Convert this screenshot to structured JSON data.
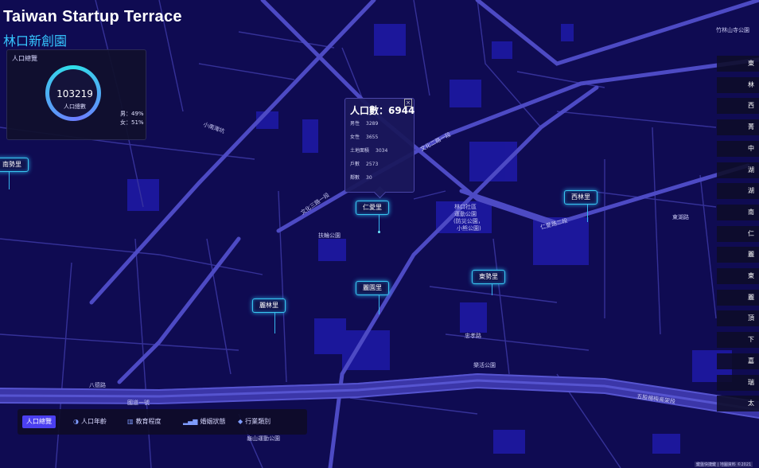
{
  "app": {
    "title": "Taiwan Startup Terrace",
    "subtitle": "林口新創園"
  },
  "population_panel": {
    "title": "人口總覽",
    "total": "103219",
    "total_label": "人口總數",
    "male": "男：49%",
    "female": "女：51%",
    "male_fraction": 0.49
  },
  "tooltip": {
    "heading": "人口數：6944",
    "close": "×",
    "rows": [
      {
        "label": "男性",
        "value": "3289"
      },
      {
        "label": "女性",
        "value": "3655"
      },
      {
        "label": "土地面積",
        "value": "3034"
      },
      {
        "label": "戶數",
        "value": "2573"
      },
      {
        "label": "鄰數",
        "value": "30"
      }
    ]
  },
  "village_labels": [
    "南勢里",
    "仁愛里",
    "西林里",
    "東勢里",
    "麗園里",
    "麗林里"
  ],
  "right_tabs": [
    "東",
    "林",
    "西",
    "菁",
    "中",
    "湖",
    "湖",
    "南",
    "仁",
    "麗",
    "東",
    "麗",
    "頂",
    "下",
    "嘉",
    "瑞",
    "太"
  ],
  "bottom_tabs": [
    {
      "label": "人口總覽",
      "icon": "",
      "active": true
    },
    {
      "label": "人口年齡",
      "icon": "pie-icon",
      "active": false
    },
    {
      "label": "教育程度",
      "icon": "bar-chart-icon",
      "active": false
    },
    {
      "label": "婚姻狀態",
      "icon": "signal-bars-icon",
      "active": false
    },
    {
      "label": "行業類別",
      "icon": "layers-icon",
      "active": false
    }
  ],
  "map_labels": {
    "park1": "林口社區",
    "park2": "運動公園",
    "park3": "(防災公園，",
    "park4": "小熊公園)",
    "fuxing": "扶輪公園",
    "lehuo": "樂活公園",
    "zhuyue": "竹林山寺公園",
    "wenhua3": "文化三路一段",
    "wenhua2": "文化二路一段",
    "renai2": "仁愛路二段",
    "wugu": "五股楊梅高架段",
    "badelu": "八德路",
    "guodao": "國道一號",
    "xiaonan": "小南灣坑",
    "zhongxiao": "忠孝路",
    "dongshan": "東湖路",
    "guilu": "龜山運動公園"
  },
  "attribution": "鍵盤快捷鍵 | 地圖資料 ©2021"
}
